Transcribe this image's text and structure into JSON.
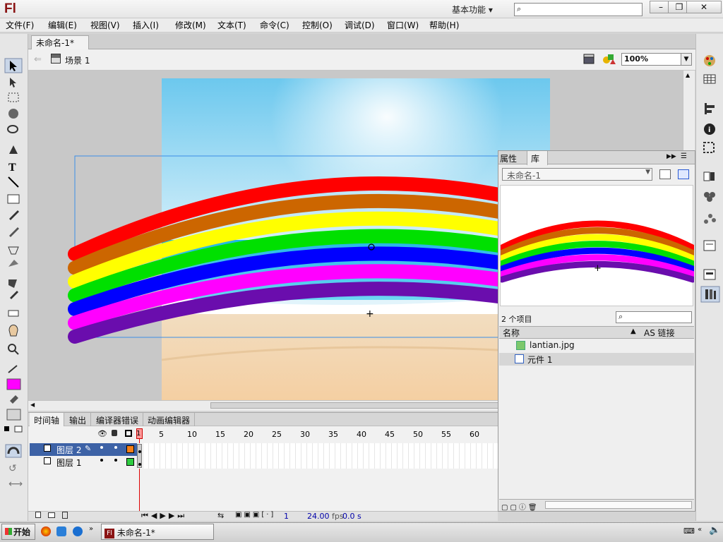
{
  "app": {
    "logo": "Fl",
    "workspace": "基本功能",
    "search_placeholder": ""
  },
  "menu": [
    "文件(F)",
    "编辑(E)",
    "视图(V)",
    "插入(I)",
    "修改(M)",
    "文本(T)",
    "命令(C)",
    "控制(O)",
    "调试(D)",
    "窗口(W)",
    "帮助(H)"
  ],
  "document": {
    "tab": "未命名-1*",
    "close": "×",
    "scene": "场景 1",
    "zoom": "100%"
  },
  "timeline": {
    "tabs": [
      "时间轴",
      "输出",
      "编译器错误",
      "动画编辑器"
    ],
    "frame_numbers": [
      "1",
      "5",
      "10",
      "15",
      "20",
      "25",
      "30",
      "35",
      "40",
      "45",
      "50",
      "55",
      "60"
    ],
    "layers": [
      {
        "name": "图层 2",
        "color": "#f57f17",
        "selected": true
      },
      {
        "name": "图层 1",
        "color": "#2ecc40",
        "selected": false
      }
    ],
    "frame": "1",
    "fps": "24.00",
    "fps_unit": "fps",
    "time": "0.0 s"
  },
  "library": {
    "tabs": [
      "属性",
      "库"
    ],
    "doc": "未命名-1",
    "count": "2 个项目",
    "col_name": "名称",
    "col_link": "AS 链接",
    "items": [
      {
        "name": "lantian.jpg",
        "icon": "bitmap-icon"
      },
      {
        "name": "元件 1",
        "icon": "graphic-symbol-icon"
      }
    ]
  },
  "tools": {
    "fill_color": "#ff00ff"
  },
  "taskbar": {
    "start": "开始",
    "task": "未命名-1*"
  },
  "rainbow_colors": [
    "#ff0000",
    "#cc6600",
    "#ffff00",
    "#00e000",
    "#0000ff",
    "#ff00ff",
    "#6a0dad"
  ]
}
